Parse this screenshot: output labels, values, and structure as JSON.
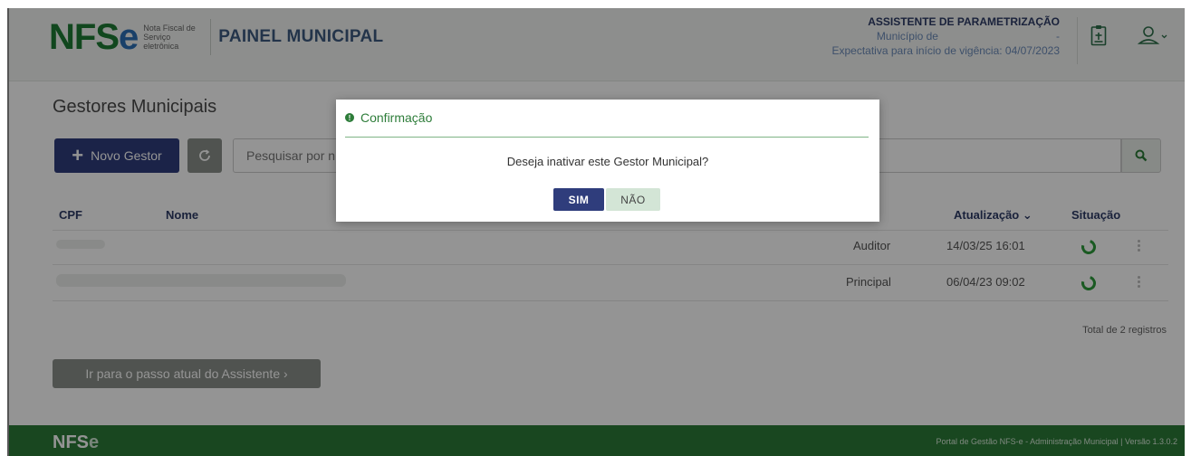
{
  "header": {
    "logo_text": "NFS",
    "logo_e": "e",
    "logo_sub_1": "Nota Fiscal de",
    "logo_sub_2": "Serviço eletrônica",
    "panel_title": "PAINEL MUNICIPAL",
    "wizard_title": "ASSISTENTE DE PARAMETRIZAÇÃO",
    "municipio": "Município de",
    "municipio_suffix": "-",
    "vigencia": "Expectativa para início de vigência: 04/07/2023"
  },
  "main": {
    "title": "Gestores Municipais",
    "new_button": "Novo Gestor",
    "search_placeholder": "Pesquisar por n",
    "columns": {
      "cpf": "CPF",
      "nome": "Nome",
      "perfil": "l",
      "atualizacao": "Atualização ⌄",
      "situacao": "Situação"
    },
    "rows": [
      {
        "perfil": "Auditor",
        "atualizacao": "14/03/25 16:01"
      },
      {
        "perfil": "Principal",
        "atualizacao": "06/04/23 09:02"
      }
    ],
    "total": "Total de 2 registros",
    "next_button": "Ir para o passo atual do Assistente ›"
  },
  "footer": {
    "logo_text": "NFS",
    "logo_e": "e",
    "text": "Portal de Gestão NFS-e - Administração Municipal | Versão 1.3.0.2"
  },
  "dialog": {
    "title": "Confirmação",
    "message": "Deseja inativar este Gestor Municipal?",
    "yes": "SIM",
    "no": "NÃO"
  },
  "colors": {
    "primary": "#2f3d7c",
    "brand_green": "#2c7a38",
    "status_green": "#2e9b3c"
  }
}
